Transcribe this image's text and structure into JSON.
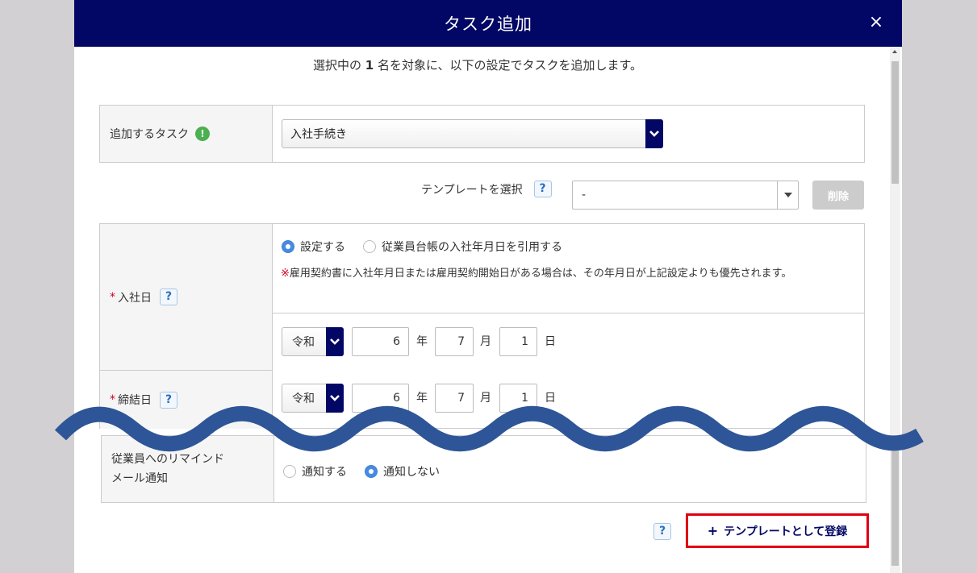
{
  "modal": {
    "title": "タスク追加",
    "close_label": "×"
  },
  "intro": {
    "prefix": "選択中の ",
    "count": "1",
    "suffix": " 名を対象に、以下の設定でタスクを追加します。"
  },
  "task": {
    "label": "追加するタスク",
    "info_glyph": "!",
    "selected": "入社手続き"
  },
  "template": {
    "label": "テンプレートを選択",
    "help": "?",
    "selected": "-",
    "delete_label": "削除"
  },
  "join_date": {
    "required_mark": "*",
    "label": "入社日",
    "help": "?",
    "options": [
      "設定する",
      "従業員台帳の入社年月日を引用する"
    ],
    "selected_option": "設定する",
    "note_mark": "※",
    "note": "雇用契約書に入社年月日または雇用契約開始日がある場合は、その年月日が上記設定よりも優先されます。",
    "era": "令和",
    "year": "6",
    "month": "7",
    "day": "1"
  },
  "contract_date": {
    "required_mark": "*",
    "label": "締結日",
    "help": "?",
    "era": "令和",
    "year": "6",
    "month": "7",
    "day": "1"
  },
  "units": {
    "year": "年",
    "month": "月",
    "day": "日"
  },
  "remind": {
    "label_line1": "従業員へのリマインド",
    "label_line2": "メール通知",
    "options": [
      "通知する",
      "通知しない"
    ],
    "selected_option": "通知しない"
  },
  "footer": {
    "help": "?",
    "register_plus": "+",
    "register_label": "テンプレートとして登録"
  },
  "colors": {
    "header_bg": "#020765",
    "accent_blue": "#4a8be0",
    "required_red": "#d4001b",
    "highlight_red": "#e00012",
    "wave": "#2e5597"
  }
}
